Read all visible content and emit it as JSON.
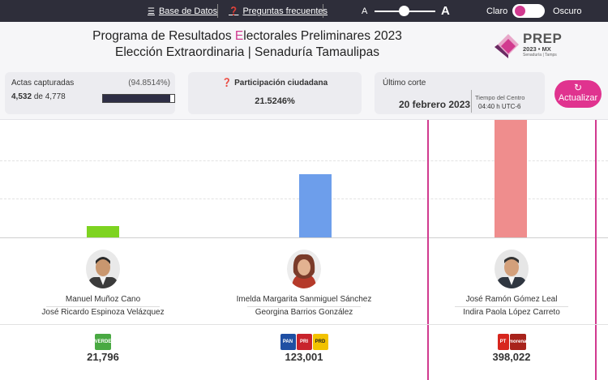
{
  "topbar": {
    "db_label": "Base de Datos",
    "faq_label": "Preguntas frecuentes",
    "font_small": "A",
    "font_big": "A",
    "theme_light": "Claro",
    "theme_dark": "Oscuro",
    "font_slider_level": 0.45
  },
  "header": {
    "title_part1": "Programa de Resultados ",
    "title_highlight": "E",
    "title_part2": "lectorales Preliminares 2023",
    "subtitle": "Elección Extraordinaria | Senaduría Tamaulipas",
    "logo_text": "PREP",
    "logo_sub": "2023 • MX",
    "logo_sub2": "Senaduría | Tamps"
  },
  "stats": {
    "actas_label": "Actas capturadas",
    "actas_pct": "(94.8514%)",
    "actas_captured": "4,532",
    "actas_of": "de",
    "actas_total": "4,778",
    "actas_progress": 0.948514,
    "participacion_label": "Participación ciudadana",
    "participacion_value": "21.5246%",
    "corte_label": "Último corte",
    "corte_date": "20 febrero 2023",
    "corte_tz": "Tiempo del Centro",
    "corte_time": "04:40 h UTC-6",
    "refresh_label": "Actualizar"
  },
  "colors": {
    "accent": "#e0338f",
    "topbar_bg": "#2e2e3a",
    "bar_pvem": "#7ed321",
    "bar_pan": "#6d9eeb",
    "bar_pt": "#ef8d8d"
  },
  "candidates": [
    {
      "name": "Manuel Muñoz Cano",
      "suplente": "José Ricardo Espinoza Velázquez",
      "votes": "21,796",
      "parties": [
        "VERDE"
      ],
      "winner": false
    },
    {
      "name": "Imelda Margarita Sanmiguel Sánchez",
      "suplente": "Georgina Barrios González",
      "votes": "123,001",
      "parties": [
        "PAN",
        "PRI",
        "PRD"
      ],
      "winner": false
    },
    {
      "name": "José Ramón Gómez Leal",
      "suplente": "Indira Paola López Carreto",
      "votes": "398,022",
      "parties": [
        "PT",
        "morena"
      ],
      "winner": true
    }
  ],
  "chart_data": {
    "type": "bar",
    "categories": [
      "Manuel Muñoz Cano",
      "Imelda Margarita Sanmiguel Sánchez",
      "José Ramón Gómez Leal"
    ],
    "values": [
      21796,
      123001,
      398022
    ],
    "ylim": [
      0,
      230000
    ],
    "grid": true
  }
}
